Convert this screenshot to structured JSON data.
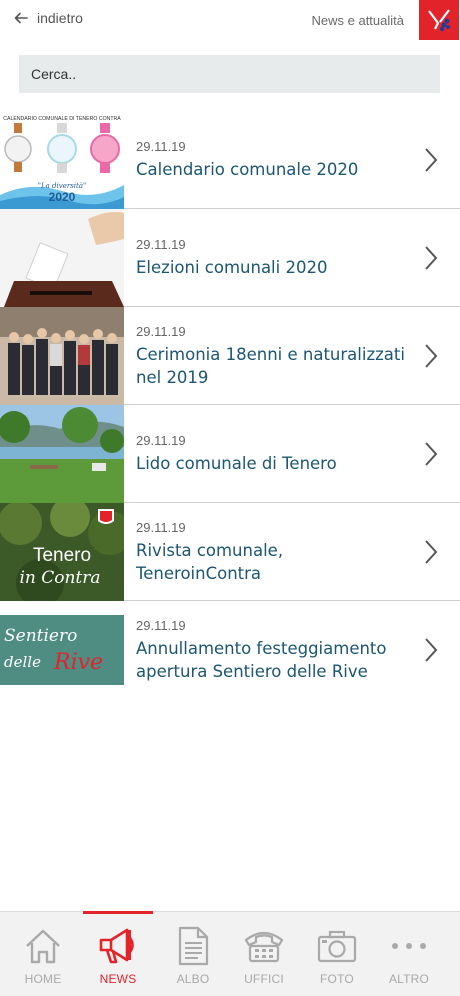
{
  "header": {
    "back_label": "indietro",
    "section_title": "News e attualità"
  },
  "search": {
    "placeholder": "Cerca.."
  },
  "news": [
    {
      "date": "29.11.19",
      "title": "Calendario comunale 2020",
      "thumb_texts": [
        "CALENDARIO COMUNALE DI TENERO CONTRA",
        "\"La diversità\"",
        "2020"
      ]
    },
    {
      "date": "29.11.19",
      "title": "Elezioni comunali 2020"
    },
    {
      "date": "29.11.19",
      "title": "Cerimonia 18enni e naturalizzati nel 2019"
    },
    {
      "date": "29.11.19",
      "title": "Lido comunale di Tenero"
    },
    {
      "date": "29.11.19",
      "title": "Rivista comunale, TeneroinContra",
      "thumb_texts": [
        "Tenero",
        "in Contra"
      ]
    },
    {
      "date": "29.11.19",
      "title": "Annullamento festeggiamento apertura Sentiero delle Rive",
      "thumb_texts": [
        "Sentiero",
        "delle",
        "Rive"
      ]
    }
  ],
  "tabs": [
    {
      "label": "HOME",
      "icon": "home-icon"
    },
    {
      "label": "NEWS",
      "icon": "megaphone-icon",
      "active": true
    },
    {
      "label": "ALBO",
      "icon": "document-icon"
    },
    {
      "label": "UFFICI",
      "icon": "phone-icon"
    },
    {
      "label": "FOTO",
      "icon": "camera-icon"
    },
    {
      "label": "ALTRO",
      "icon": "more-icon"
    }
  ],
  "colors": {
    "accent": "#e3232a",
    "title": "#1b5672",
    "search_bg": "#e7ebec"
  }
}
